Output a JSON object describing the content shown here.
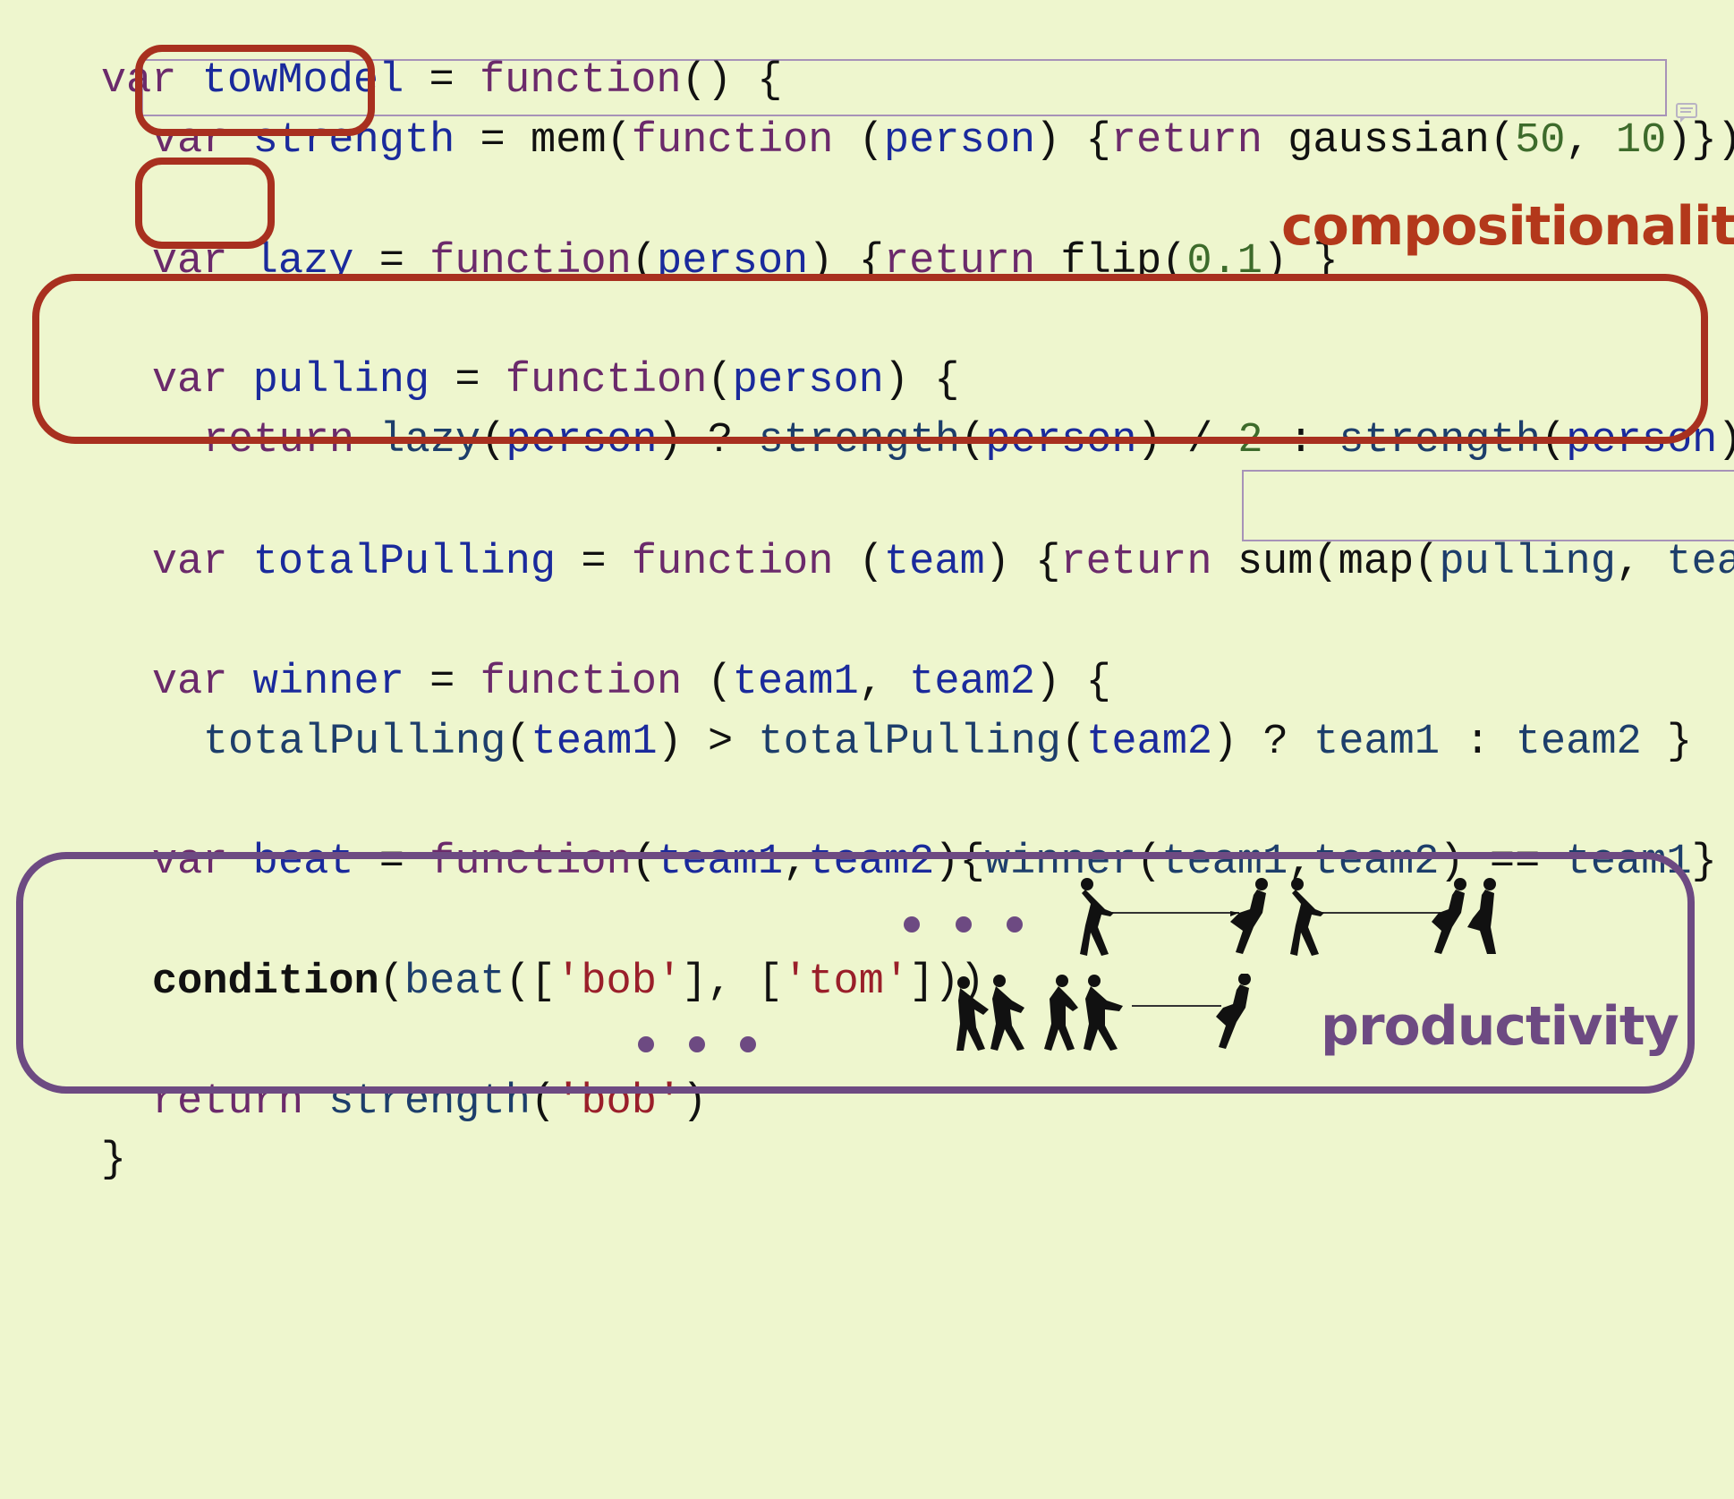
{
  "code": {
    "l1": [
      "var",
      "towModel",
      "=",
      "function",
      "()",
      "{"
    ],
    "l2": [
      "var",
      "strength",
      "=",
      "mem(",
      "function",
      "(",
      "person",
      ")",
      "{",
      "return",
      "gaussian(",
      "50",
      ",",
      "10",
      ")})"
    ],
    "l3": [
      "var",
      "lazy",
      "=",
      "function",
      "(",
      "person",
      ")",
      "{",
      "return",
      "flip(",
      "0.1",
      ")",
      "}"
    ],
    "l4": [
      "var",
      "pulling",
      "=",
      "function",
      "(",
      "person",
      ")",
      "{"
    ],
    "l5": [
      "return",
      "lazy",
      "(",
      "person",
      ")",
      "?",
      "strength",
      "(",
      "person",
      ")",
      "/",
      "2",
      ":",
      "strength",
      "(",
      "person",
      ")"
    ],
    "l6": [
      "var",
      "totalPulling",
      "=",
      "function",
      "(",
      "team",
      ")",
      "{",
      "return",
      "sum(",
      "map(",
      "pulling",
      ",",
      "team",
      "))"
    ],
    "l7": [
      "var",
      "winner",
      "=",
      "function",
      "(",
      "team1",
      ",",
      "team2",
      ")",
      "{"
    ],
    "l8": [
      "totalPulling",
      "(",
      "team1",
      ")",
      ">",
      "totalPulling",
      "(",
      "team2",
      ")",
      "?",
      "team1",
      ":",
      "team2",
      "}"
    ],
    "l9": [
      "var",
      "beat",
      "=",
      "function",
      "(",
      "team1",
      ",",
      "team2",
      ")",
      "{",
      "winner",
      "(",
      "team1",
      ",",
      "team2",
      ")",
      "==",
      "team1",
      "}"
    ],
    "l10": [
      "condition",
      "(",
      "beat",
      "([",
      "'bob'",
      "],",
      "[",
      "'tom'",
      "]))"
    ],
    "l11": [
      "return",
      "strength",
      "(",
      "'bob'",
      ")"
    ],
    "l12": "}"
  },
  "labels": {
    "compositionality": "compositionality",
    "productivity": "productivity"
  },
  "colors": {
    "background": "#eef6ce",
    "keyword": "#6b2a6b",
    "identifier": "#1a2a9c",
    "number": "#3d6b2b",
    "string": "#9a1f2a",
    "red_box": "#a8301f",
    "purple_box": "#6d4a82"
  },
  "icons": [
    "comment-icon",
    "tug-of-war-1v1-icon",
    "tug-of-war-1v2-icon",
    "tug-of-war-4v1-icon"
  ]
}
